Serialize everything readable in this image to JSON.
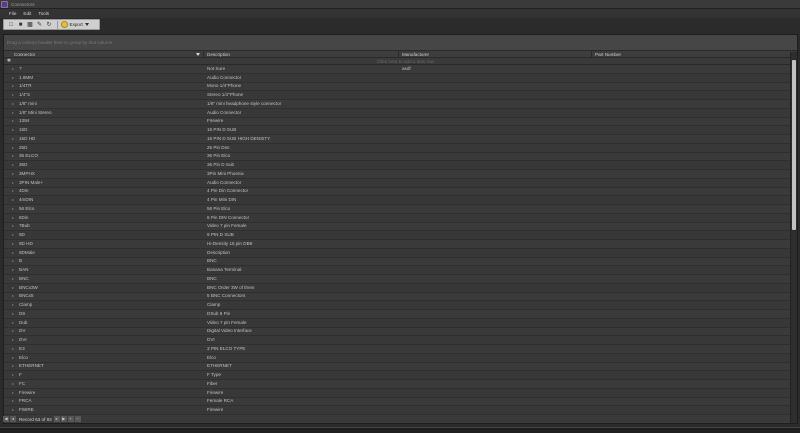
{
  "window": {
    "title": "Connectors"
  },
  "menu": [
    "File",
    "Edit",
    "Tools"
  ],
  "toolbar": {
    "export_label": "Export"
  },
  "grid": {
    "group_panel_text": "Drag a column header here to group by that column",
    "columns": [
      "Connector",
      "Description",
      "Manufacturer",
      "Part Number"
    ],
    "new_row_text": "Click here to add a new row",
    "rows": [
      [
        "?",
        "Not Sure",
        "asdf",
        ""
      ],
      [
        "1.8MM",
        "Audio Connector",
        "",
        ""
      ],
      [
        "1/4TR",
        "Mono 1/4\"Phone",
        "",
        ""
      ],
      [
        "1/4\"S",
        "Stereo 1/4\"Phone",
        "",
        ""
      ],
      [
        "1/8\" mini",
        "1/8\" mini headphone style connector",
        "",
        ""
      ],
      [
        "1/8\" Mini Stereo",
        "Audio Connector",
        "",
        ""
      ],
      [
        "1394",
        "Firewire",
        "",
        ""
      ],
      [
        "15D",
        "15 PIN D SUB",
        "",
        ""
      ],
      [
        "15D HD",
        "15 PIN D SUB HIGH DENSITY",
        "",
        ""
      ],
      [
        "25D",
        "25 Pin Dsn",
        "",
        ""
      ],
      [
        "36 ELCO",
        "36 Pin Elco",
        "",
        ""
      ],
      [
        "36D",
        "36 Pin D Sub",
        "",
        ""
      ],
      [
        "3MPHX",
        "3Pin Mini Phoenix",
        "",
        ""
      ],
      [
        "3PIN Male+",
        "Audio Connector",
        "",
        ""
      ],
      [
        "4Din",
        "4 Pin Din Connector",
        "",
        ""
      ],
      [
        "4mDIN",
        "4 Pin Mini DIN",
        "",
        ""
      ],
      [
        "56 Elco",
        "56 Pin Elco",
        "",
        ""
      ],
      [
        "6Din",
        "6 Pin DIN Connector",
        "",
        ""
      ],
      [
        "7Bub",
        "Video 7 pin Female",
        "",
        ""
      ],
      [
        "9D",
        "9 PIN D SUB",
        "",
        ""
      ],
      [
        "9D HD",
        "Hi-Density 15 pin DB9",
        "",
        ""
      ],
      [
        "9DMale",
        "Description",
        "",
        ""
      ],
      [
        "B",
        "BNC",
        "",
        ""
      ],
      [
        "BAN",
        "Banana Terminal",
        "",
        ""
      ],
      [
        "BNC",
        "BNC",
        "",
        ""
      ],
      [
        "BNCx3W",
        "BNC Order 3W of them",
        "",
        ""
      ],
      [
        "BNCx5",
        "5 BNC Connectors",
        "",
        ""
      ],
      [
        "Clamp",
        "Clamp",
        "",
        ""
      ],
      [
        "D9",
        "DSub 9 Pin",
        "",
        ""
      ],
      [
        "Dub",
        "Video 7 pin Female",
        "",
        ""
      ],
      [
        "DV",
        "Digital Video Interface",
        "",
        ""
      ],
      [
        "DVI",
        "DVI",
        "",
        ""
      ],
      [
        "E3",
        "3 PIN ELCO TYPE",
        "",
        ""
      ],
      [
        "Elco",
        "Elco",
        "",
        ""
      ],
      [
        "ETHERNET",
        "ETHERNET",
        "",
        ""
      ],
      [
        "F",
        "F Type",
        "",
        ""
      ],
      [
        "FC",
        "Fiber",
        "",
        ""
      ],
      [
        "Firewire",
        "Firewire",
        "",
        ""
      ],
      [
        "FRCA",
        "Female RCA",
        "",
        ""
      ],
      [
        "FWIRE",
        "Firewire",
        "",
        ""
      ]
    ]
  },
  "navigator": {
    "record_label": "Record 63 of 93"
  }
}
